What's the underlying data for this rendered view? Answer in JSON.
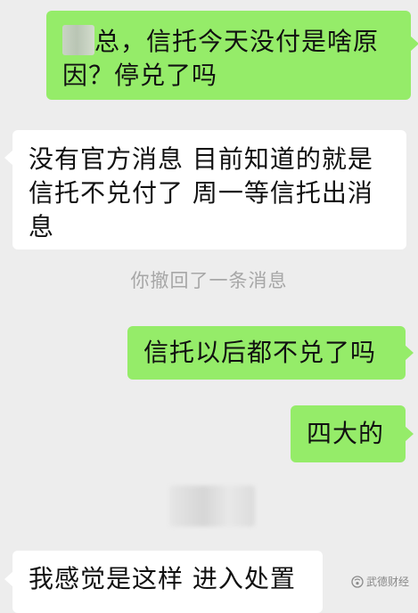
{
  "messages": [
    {
      "id": "m1",
      "side": "sent",
      "line1_after_blur": "总，信托今天没付是啥原",
      "line2": "因？停兑了吗"
    },
    {
      "id": "m2",
      "side": "received",
      "lines": [
        "没有官方消息 目前知道的就是",
        "信托不兑付了 周一等信托出消",
        "息"
      ]
    },
    {
      "id": "m3",
      "side": "sent",
      "text": "信托以后都不兑了吗"
    },
    {
      "id": "m4",
      "side": "sent",
      "text": "四大的"
    },
    {
      "id": "m5",
      "side": "received",
      "text": "我感觉是这样 进入处置"
    }
  ],
  "system_notice": "你撤回了一条消息",
  "watermark": {
    "text": "武德财经",
    "icon": "wechat-official-account-icon"
  },
  "colors": {
    "background": "#ededed",
    "sent_bubble": "#95ec69",
    "received_bubble": "#ffffff",
    "system_text": "#a7a7a7"
  }
}
